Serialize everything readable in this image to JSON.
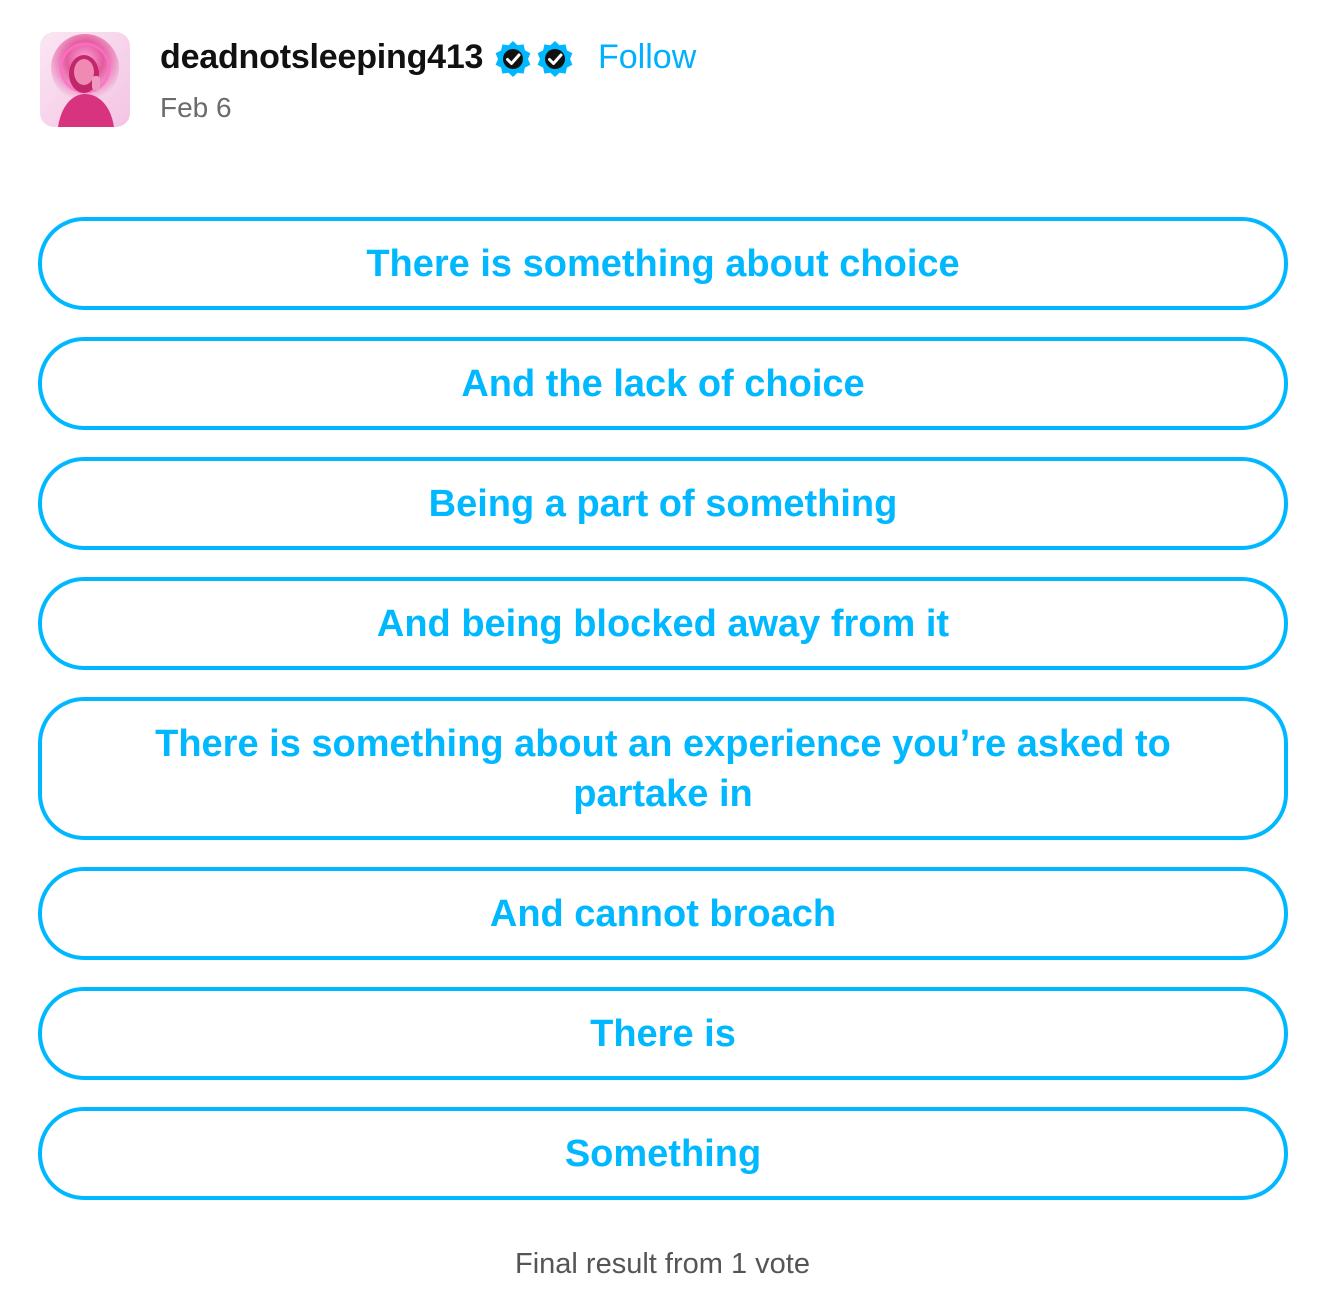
{
  "post": {
    "username": "deadnotsleeping413",
    "follow_label": "Follow",
    "date": "Feb 6",
    "avatar_icon": "user-avatar",
    "badges": [
      "verified-badge-icon",
      "verified-badge-icon"
    ],
    "accent_color": "#00b8ff"
  },
  "poll": {
    "options": [
      "There is something about choice",
      "And the lack of choice",
      "Being a part of something",
      "And being blocked away from it",
      "There is something about an experience you’re asked to partake in",
      "And cannot broach",
      "There is",
      "Something"
    ],
    "result_text": "Final result from 1 vote"
  }
}
